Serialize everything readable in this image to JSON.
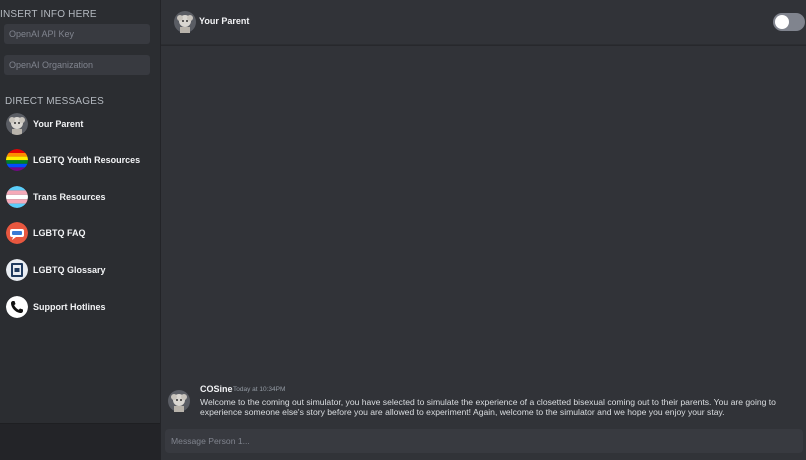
{
  "sidebar": {
    "insert_title": "INSERT INFO HERE",
    "api_key_placeholder": "OpenAI API Key",
    "org_placeholder": "OpenAI Organization",
    "dm_title": "DIRECT MESSAGES",
    "items": [
      {
        "label": "Your Parent",
        "icon": "parent-avatar-icon"
      },
      {
        "label": "LGBTQ Youth Resources",
        "icon": "rainbow-flag-icon"
      },
      {
        "label": "Trans Resources",
        "icon": "trans-flag-icon"
      },
      {
        "label": "LGBTQ FAQ",
        "icon": "faq-icon"
      },
      {
        "label": "LGBTQ Glossary",
        "icon": "glossary-book-icon"
      },
      {
        "label": "Support Hotlines",
        "icon": "phone-icon"
      }
    ]
  },
  "header": {
    "title": "Your Parent",
    "avatar_icon": "parent-avatar-icon",
    "toggle_state": "off"
  },
  "messages": [
    {
      "author": "COSine",
      "time": "Today at 10:34PM",
      "text": "Welcome to the coming out simulator, you have selected to simulate the experience of a closetted bisexual coming out to their parents. You are going to experience someone else's story before you are allowed to experiment! Again, welcome to the simulator and we hope you enjoy your stay."
    }
  ],
  "composer": {
    "placeholder": "Message Person 1..."
  },
  "colors": {
    "background": "#313338",
    "sidebar": "#2b2d31",
    "input": "#383a40",
    "text": "#f2f3f5"
  }
}
